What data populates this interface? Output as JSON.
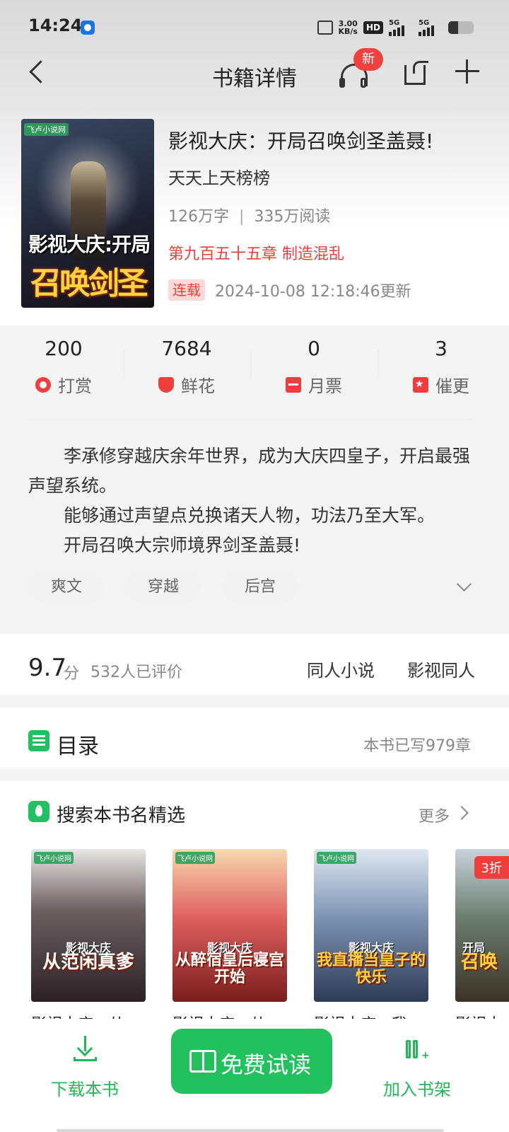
{
  "status_bar": {
    "time": "14:24",
    "speed_value": "3.00",
    "speed_unit": "KB/s",
    "hd_label": "HD",
    "network_1": "5G",
    "network_2": "5G"
  },
  "nav": {
    "title": "书籍详情",
    "badge": "新"
  },
  "book": {
    "cover_title_line1": "影视大庆:开局",
    "cover_title_line2": "召唤剑圣",
    "cover_logo": "飞卢小说网",
    "title": "影视大庆：开局召唤剑圣盖聂!",
    "author": "天天上天榜榜",
    "word_count": "126万字",
    "stat_separator": "|",
    "reads": "335万阅读",
    "latest_chapter": "第九百五十五章 制造混乱",
    "status": "连载",
    "updated": "2024-10-08 12:18:46更新"
  },
  "interactions": [
    {
      "count": "200",
      "label": "打赏",
      "icon": "gift-icon"
    },
    {
      "count": "7684",
      "label": "鲜花",
      "icon": "flower-icon"
    },
    {
      "count": "0",
      "label": "月票",
      "icon": "ticket-icon"
    },
    {
      "count": "3",
      "label": "催更",
      "icon": "urge-icon"
    }
  ],
  "intro": {
    "p1": "李承修穿越庆余年世界，成为大庆四皇子，开启最强声望系统。",
    "p2": "能够通过声望点兑换诸天人物，功法乃至大军。",
    "p3": "开局召唤大宗师境界剑圣盖聂!"
  },
  "tags": [
    "爽文",
    "穿越",
    "后宫"
  ],
  "rating": {
    "score": "9.7",
    "unit": "分",
    "count": "532人已评价",
    "categories": [
      "同人小说",
      "影视同人"
    ]
  },
  "toc": {
    "title": "目录",
    "count": "本书已写979章"
  },
  "selection": {
    "title": "搜索本书名精选",
    "more": "更多",
    "books": [
      {
        "title": "影视大庆：从",
        "cover_line1": "影视大庆",
        "cover_line2": "从范闲真爹"
      },
      {
        "title": "影视大庆：从",
        "cover_line1": "影视大庆",
        "cover_line2": "从醉宿皇后寝宫开始"
      },
      {
        "title": "影视大庆：我",
        "cover_line1": "影视大庆",
        "cover_line2": "我直播当皇子的快乐"
      },
      {
        "title": "影视大",
        "cover_line1": "开局",
        "cover_line2": "召唤",
        "discount": "3折"
      }
    ]
  },
  "bottom": {
    "download": "下载本书",
    "read": "免费试读",
    "shelf": "加入书架"
  },
  "colors": {
    "accent_green": "#22c15e",
    "accent_red": "#e8403a"
  }
}
